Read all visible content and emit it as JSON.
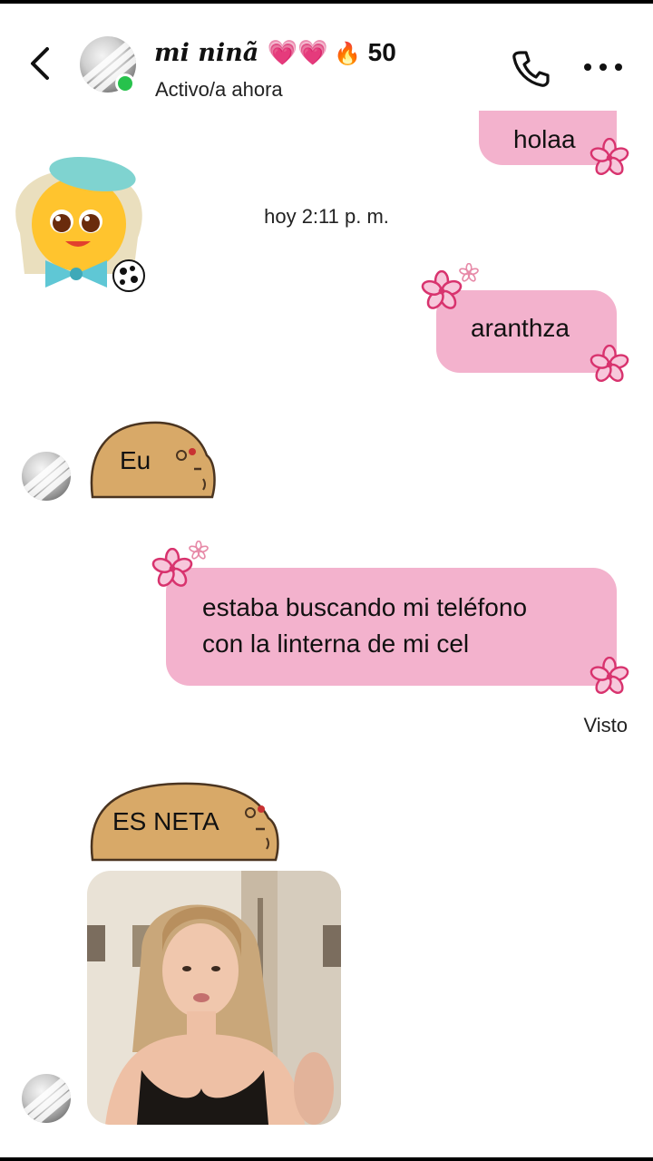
{
  "header": {
    "contact_name": "mi ninã",
    "name_emojis": "💗💗",
    "streak_emoji": "🔥",
    "streak_count": "50",
    "status": "Activo/a ahora",
    "back_icon": "chevron-left-icon",
    "call_icon": "phone-icon",
    "more_icon": "more-horizontal-icon"
  },
  "messages": {
    "m1_text": "holaa",
    "timestamp": "hoy 2:11 p. m.",
    "m2_text": "aranthza",
    "m3_sticker_text": "Eu",
    "m4_text_line1": "estaba buscando mi teléfono",
    "m4_text_line2": "con la linterna de mi cel",
    "seen_label": "Visto",
    "m5_sticker_text": "ES NETA"
  },
  "colors": {
    "bubble_pink": "#f3b2cd",
    "flower_magenta": "#d8336e",
    "online_green": "#27c24c",
    "capybara_brown": "#d8a968"
  }
}
